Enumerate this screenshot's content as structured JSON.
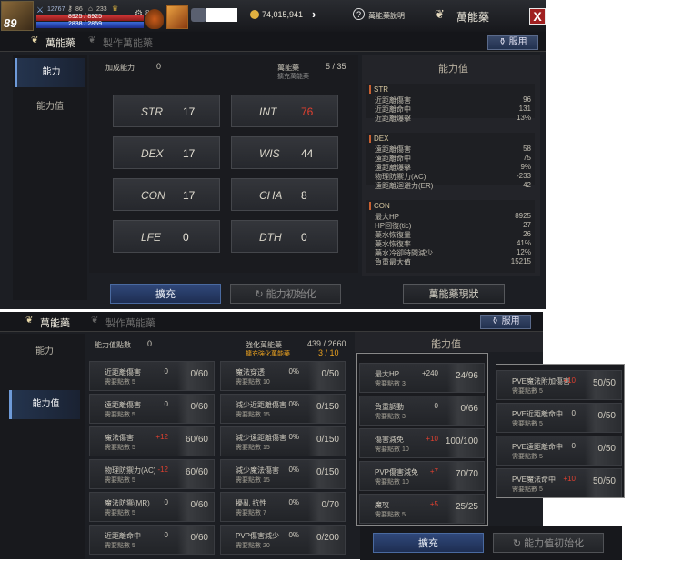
{
  "top": {
    "level": "89",
    "stat_a": "12767",
    "stat_b": "86",
    "stat_c": "233",
    "stat_d": "8",
    "hp": "8925 / 8925",
    "mp": "2838 / 2859",
    "gold": "74,015,941",
    "help_label": "萬能藥說明",
    "title": "萬能藥",
    "close": "X"
  },
  "tabs": {
    "t1": "萬能藥",
    "t2": "製作萬能藥",
    "use": "服用"
  },
  "side": {
    "ability": "能力",
    "ability_value": "能力值"
  },
  "top_panel": {
    "points_label": "加成能力",
    "points": "0",
    "elixir_label": "萬能藥",
    "elixir_sub": "擴充萬能藥",
    "elixir_count": "5 / 35",
    "stats": [
      {
        "name": "STR",
        "value": "17",
        "red": false
      },
      {
        "name": "INT",
        "value": "76",
        "red": true
      },
      {
        "name": "DEX",
        "value": "17",
        "red": false
      },
      {
        "name": "WIS",
        "value": "44",
        "red": false
      },
      {
        "name": "CON",
        "value": "17",
        "red": false
      },
      {
        "name": "CHA",
        "value": "8",
        "red": false
      },
      {
        "name": "LFE",
        "value": "0",
        "red": false
      },
      {
        "name": "DTH",
        "value": "0",
        "red": false
      }
    ],
    "right_title": "能力值",
    "str": {
      "title": "STR",
      "rows": [
        [
          "近距離傷害",
          "96"
        ],
        [
          "近距離命中",
          "131"
        ],
        [
          "近距離爆擊",
          "13%"
        ]
      ]
    },
    "dex": {
      "title": "DEX",
      "rows": [
        [
          "遠距離傷害",
          "58"
        ],
        [
          "遠距離命中",
          "75"
        ],
        [
          "遠距離爆擊",
          "9%"
        ],
        [
          "物理防禦力(AC)",
          "-233"
        ],
        [
          "遠距離迴避力(ER)",
          "42"
        ]
      ]
    },
    "con": {
      "title": "CON",
      "rows": [
        [
          "最大HP",
          "8925"
        ],
        [
          "HP回復(tic)",
          "27"
        ],
        [
          "藥水恢復量",
          "26"
        ],
        [
          "藥水恢復率",
          "41%"
        ],
        [
          "藥水冷卻時間減少",
          "12%"
        ],
        [
          "負重最大值",
          "15215"
        ]
      ]
    },
    "btn_expand": "擴充",
    "btn_reset": "能力初始化",
    "btn_status": "萬能藥現狀"
  },
  "bottom_panel": {
    "points_label": "能力值點數",
    "points": "0",
    "elixir_label": "強化萬能藥",
    "elixir_count": "439 / 2660",
    "elixir_sub": "擴充強化萬能藥",
    "elixir_sub_count": "3 / 10",
    "right_title": "能力值",
    "need": "需要點數",
    "col1": [
      {
        "n": "近距離傷害",
        "s": "5",
        "b": "0",
        "br": false,
        "p": "0/60"
      },
      {
        "n": "遠距離傷害",
        "s": "5",
        "b": "0",
        "br": false,
        "p": "0/60"
      },
      {
        "n": "魔法傷害",
        "s": "5",
        "b": "+12",
        "br": true,
        "p": "60/60"
      },
      {
        "n": "物理防禦力(AC)",
        "s": "5",
        "b": "-12",
        "br": true,
        "p": "60/60"
      },
      {
        "n": "魔法防禦(MR)",
        "s": "5",
        "b": "0",
        "br": false,
        "p": "0/60"
      },
      {
        "n": "近距離命中",
        "s": "5",
        "b": "0",
        "br": false,
        "p": "0/60"
      }
    ],
    "col2": [
      {
        "n": "魔法穿透",
        "s": "10",
        "b": "0%",
        "br": false,
        "p": "0/50"
      },
      {
        "n": "減少近距離傷害",
        "s": "15",
        "b": "0%",
        "br": false,
        "p": "0/150"
      },
      {
        "n": "減少遠距離傷害",
        "s": "15",
        "b": "0%",
        "br": false,
        "p": "0/150"
      },
      {
        "n": "減少魔法傷害",
        "s": "15",
        "b": "0%",
        "br": false,
        "p": "0/150"
      },
      {
        "n": "擾亂 抗性",
        "s": "7",
        "b": "0%",
        "br": false,
        "p": "0/70"
      },
      {
        "n": "PVP傷害減少",
        "s": "20",
        "b": "0%",
        "br": false,
        "p": "0/200"
      }
    ],
    "col3": [
      {
        "n": "最大HP",
        "s": "3",
        "b": "+240",
        "br": false,
        "p": "24/96"
      },
      {
        "n": "負重調動",
        "s": "3",
        "b": "0",
        "br": false,
        "p": "0/66"
      },
      {
        "n": "傷害減免",
        "s": "10",
        "b": "+10",
        "br": true,
        "p": "100/100"
      },
      {
        "n": "PVP傷害減免",
        "s": "10",
        "b": "+7",
        "br": true,
        "p": "70/70"
      },
      {
        "n": "魔攻",
        "s": "5",
        "b": "+5",
        "br": true,
        "p": "25/25"
      }
    ],
    "col4": [
      {
        "n": "PVE魔法附加傷害",
        "s": "5",
        "b": "+10",
        "br": true,
        "p": "50/50"
      },
      {
        "n": "PVE近距離命中",
        "s": "5",
        "b": "0",
        "br": false,
        "p": "0/50"
      },
      {
        "n": "PVE遠距離命中",
        "s": "5",
        "b": "0",
        "br": false,
        "p": "0/50"
      },
      {
        "n": "PVE魔法命中",
        "s": "5",
        "b": "+10",
        "br": true,
        "p": "50/50"
      }
    ],
    "btn_expand": "擴充",
    "btn_reset": "能力值初始化"
  }
}
